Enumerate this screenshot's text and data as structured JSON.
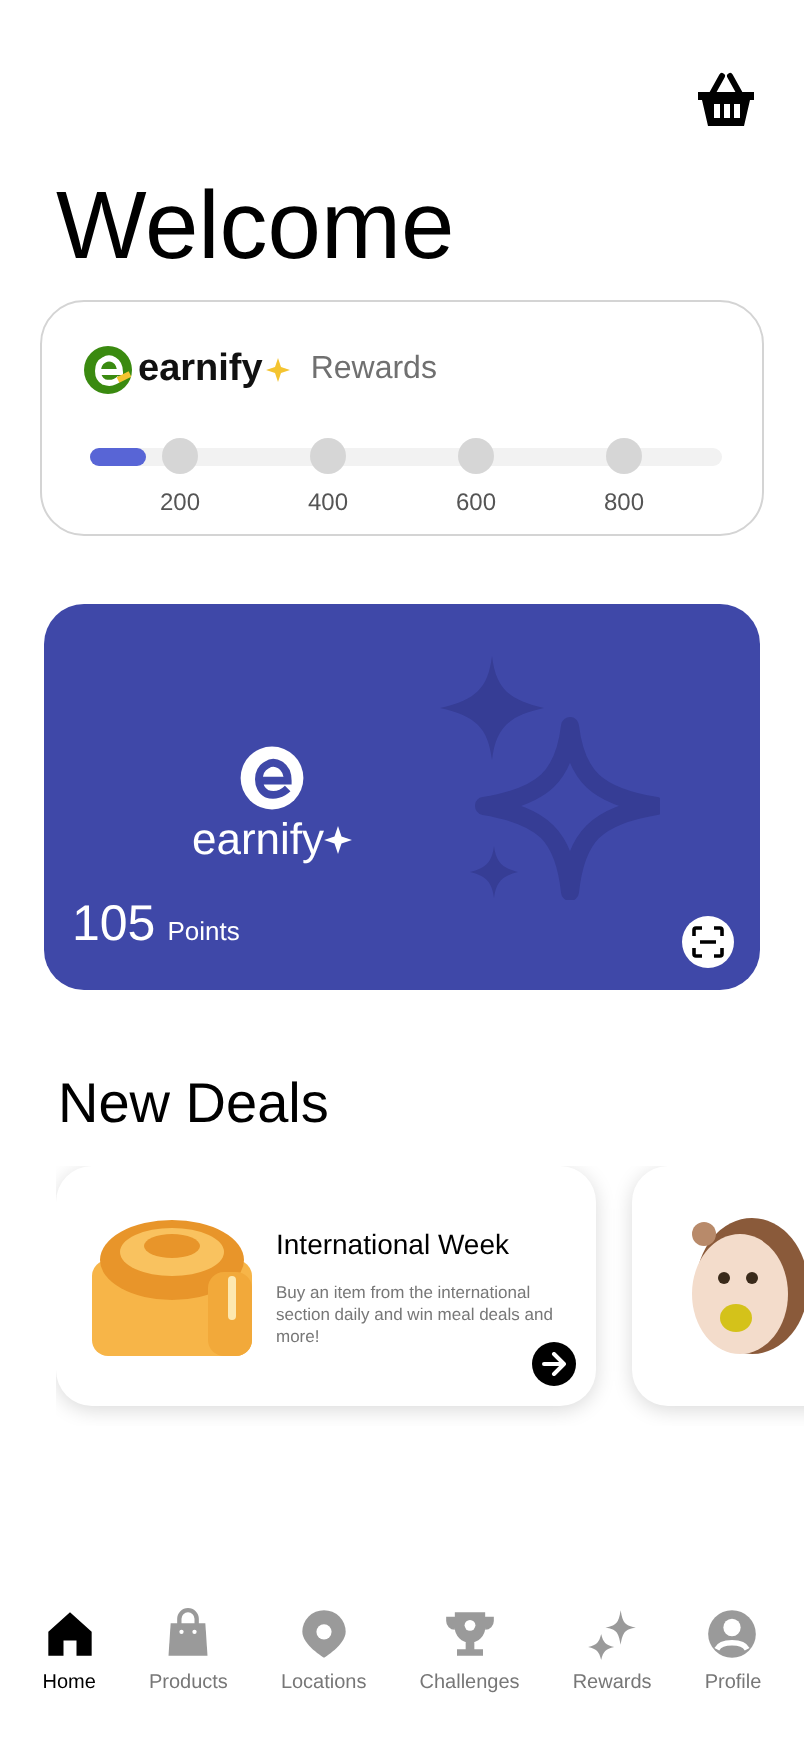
{
  "greeting": "Welcome",
  "rewards_card": {
    "brand": "earnify",
    "label": "Rewards",
    "progress": {
      "level": 0.09
    },
    "milestones": [
      {
        "label": "200",
        "reached": false
      },
      {
        "label": "400",
        "reached": false
      },
      {
        "label": "600",
        "reached": false
      },
      {
        "label": "800",
        "reached": false
      }
    ]
  },
  "points_card": {
    "brand": "earnify",
    "points": "105",
    "unit": "Points"
  },
  "deals": {
    "title": "New Deals",
    "items": [
      {
        "kind": "full",
        "title": "International Week",
        "description": "Buy an item from the international section daily and win meal deals and more!"
      },
      {
        "kind": "peek"
      }
    ]
  },
  "bottom_nav": [
    {
      "label": "Home",
      "selected": true
    },
    {
      "label": "Products",
      "selected": false
    },
    {
      "label": "Locations",
      "selected": false
    },
    {
      "label": "Challenges",
      "selected": false
    },
    {
      "label": "Rewards",
      "selected": false
    },
    {
      "label": "Profile",
      "selected": false
    }
  ]
}
